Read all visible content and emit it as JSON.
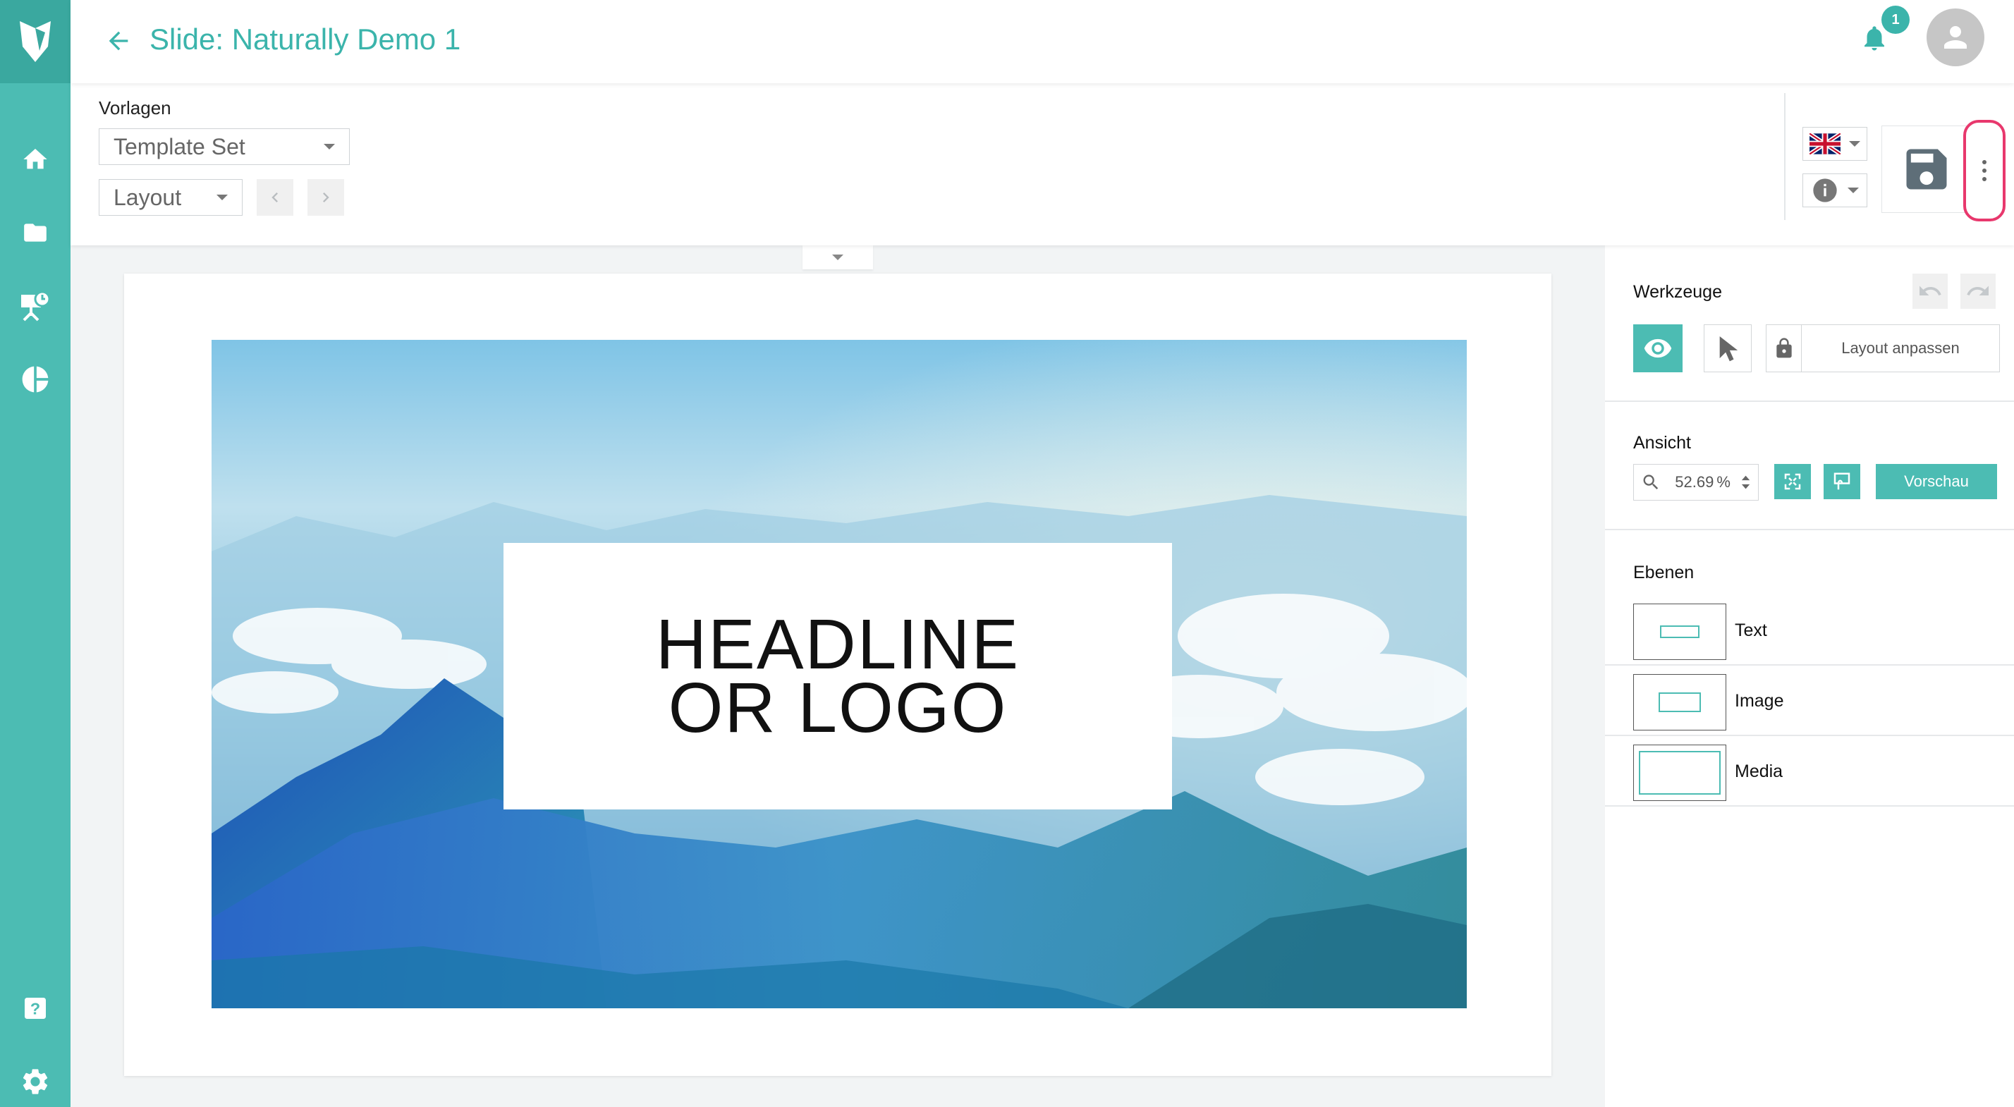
{
  "header": {
    "title": "Slide: Naturally Demo 1",
    "notification_count": "1"
  },
  "toolbar": {
    "vorlagen_label": "Vorlagen",
    "template_set": "Template Set",
    "layout": "Layout"
  },
  "slide": {
    "headline_line1": "HEADLINE",
    "headline_line2": "OR LOGO"
  },
  "panel": {
    "werkzeuge": "Werkzeuge",
    "layout_anpassen": "Layout anpassen",
    "ansicht": "Ansicht",
    "zoom_value": "52.69",
    "zoom_unit": "%",
    "vorschau": "Vorschau",
    "ebenen": "Ebenen",
    "layers": [
      {
        "label": "Text"
      },
      {
        "label": "Image"
      },
      {
        "label": "Media"
      }
    ]
  },
  "colors": {
    "accent": "#4cbcb3",
    "highlight": "#e8386d"
  },
  "icons": {
    "sidebar": [
      "home-icon",
      "folder-icon",
      "presentation-icon",
      "pie-chart-icon",
      "help-icon",
      "settings-icon"
    ]
  }
}
